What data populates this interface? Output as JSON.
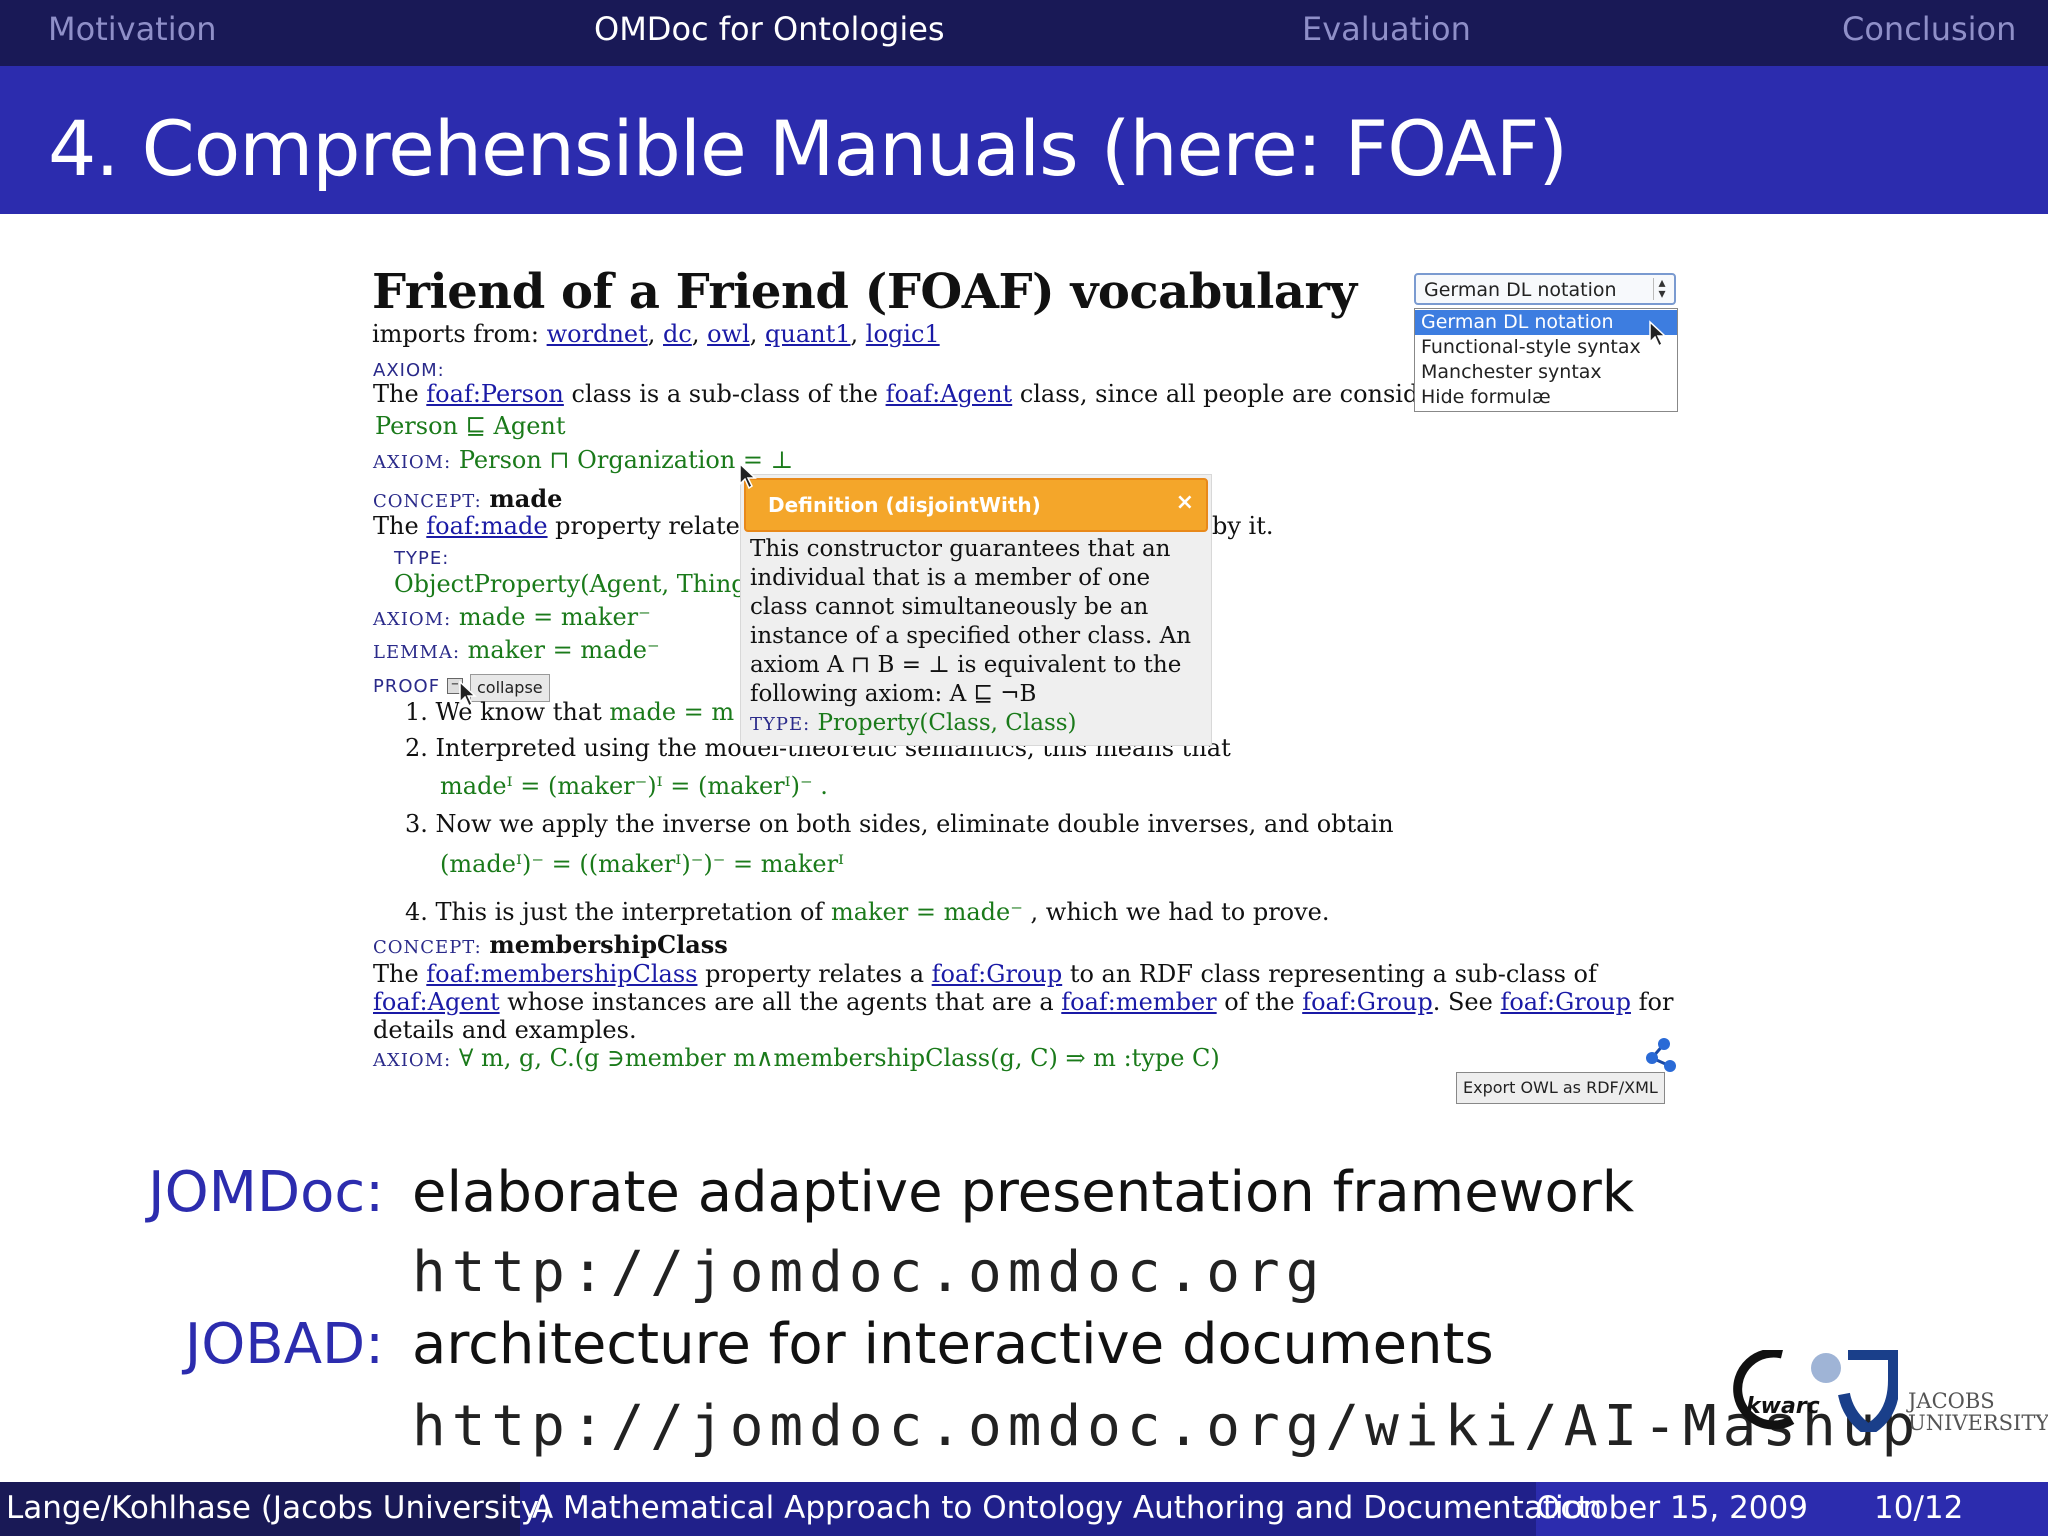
{
  "nav": {
    "items": [
      "Motivation",
      "OMDoc for Ontologies",
      "Evaluation",
      "Conclusion"
    ],
    "active": "OMDoc for Ontologies"
  },
  "slide": {
    "title": "4. Comprehensible Manuals (here: FOAF)"
  },
  "document": {
    "title": "Friend of a Friend (FOAF) vocabulary",
    "imports_label": "imports from:",
    "imports": [
      "wordnet",
      "dc",
      "owl",
      "quant1",
      "logic1"
    ],
    "axiom_label": "AXIOM:",
    "concept_label": "CONCEPT:",
    "type_label": "TYPE:",
    "lemma_label": "LEMMA:",
    "proof_label": "PROOF",
    "axiom1": {
      "pre": "The ",
      "link1": "foaf:Person",
      "mid": " class is a sub-class of the ",
      "link2": "foaf:Agent",
      "post": " class, since all people are conside",
      "formula": "Person ⊑ Agent"
    },
    "axiom2_formula": "Person ⊓ Organization = ⊥",
    "concept_made": {
      "name": "made",
      "pre": "The ",
      "link": "foaf:made",
      "mid": " property relate",
      "post": "by it.",
      "type": "ObjectProperty(Agent, Thing",
      "axiom": "made = maker⁻",
      "lemma": "maker = made⁻"
    },
    "proof": {
      "collapse": "collapse",
      "step1_num": "1.",
      "step1_text": "We know that ",
      "step1_formula": "made = m",
      "step2_num": "2.",
      "step2_text": "Interpreted using the model-theoretic semantics, this means that",
      "step2_formula": "madeᴵ = (maker⁻)ᴵ = (makerᴵ)⁻ .",
      "step3_num": "3.",
      "step3_text": "Now we apply the inverse on both sides, eliminate double inverses, and obtain",
      "step3_formula": "(madeᴵ)⁻ = ((makerᴵ)⁻)⁻ = makerᴵ",
      "step4_num": "4.",
      "step4_text": "This is just the interpretation of ",
      "step4_formula": "maker = made⁻",
      "step4_post": " , which we had to prove."
    },
    "concept_membership": {
      "name": "membershipClass",
      "l1_pre": "The ",
      "l1_link1": "foaf:membershipClass",
      "l1_mid": " property relates a ",
      "l1_link2": "foaf:Group",
      "l1_post": " to an RDF class representing a sub-class of",
      "l2_link1": "foaf:Agent",
      "l2_mid1": " whose instances are all the agents that are a ",
      "l2_link2": "foaf:member",
      "l2_mid2": " of the ",
      "l2_link3": "foaf:Group",
      "l2_mid3": ". See ",
      "l2_link4": "foaf:Group",
      "l2_post": " for",
      "l3": "details and examples.",
      "axiom": "∀ m, g, C.(g ∋member m∧membershipClass(g, C) ⇒ m :type C)"
    }
  },
  "dropdown": {
    "selected": "German DL notation",
    "options": [
      "German DL notation",
      "Functional-style syntax",
      "Manchester syntax",
      "Hide formulæ"
    ]
  },
  "popup": {
    "title": "Definition (disjointWith)",
    "close": "×",
    "lines": [
      "This constructor guarantees that an",
      "individual that is a member of one",
      "class cannot simultaneously be an",
      "instance of a specified other class. An",
      "axiom A ⊓ B = ⊥ is equivalent to the",
      "following axiom: A ⊑ ¬B"
    ],
    "type_label": "TYPE:",
    "type_value": "Property(Class, Class)"
  },
  "export_button": "Export OWL as RDF/XML",
  "bullets": [
    {
      "label": "JOMDoc:",
      "text": "elaborate adaptive presentation framework",
      "url": "http://jomdoc.omdoc.org"
    },
    {
      "label": "JOBAD:",
      "text": "architecture for interactive documents",
      "url": "http://jomdoc.omdoc.org/wiki/AI-Mashup"
    }
  ],
  "logos": {
    "kwarc": "kwarc",
    "jacobs_line1": "JACOBS",
    "jacobs_line2": "UNIVERSITY"
  },
  "footer": {
    "authors": "Lange/Kohlhase  (Jacobs University)",
    "talk_title": "A Mathematical Approach to Ontology Authoring and Documentation",
    "date": "October 15, 2009",
    "page": "10/12"
  },
  "colors": {
    "nav_bg": "#191956",
    "title_bg": "#2c2cae",
    "label": "#2c2cae",
    "formula_green": "#1a7a1a",
    "link_blue": "#1a1aa6",
    "popup_orange": "#f4a62a"
  }
}
